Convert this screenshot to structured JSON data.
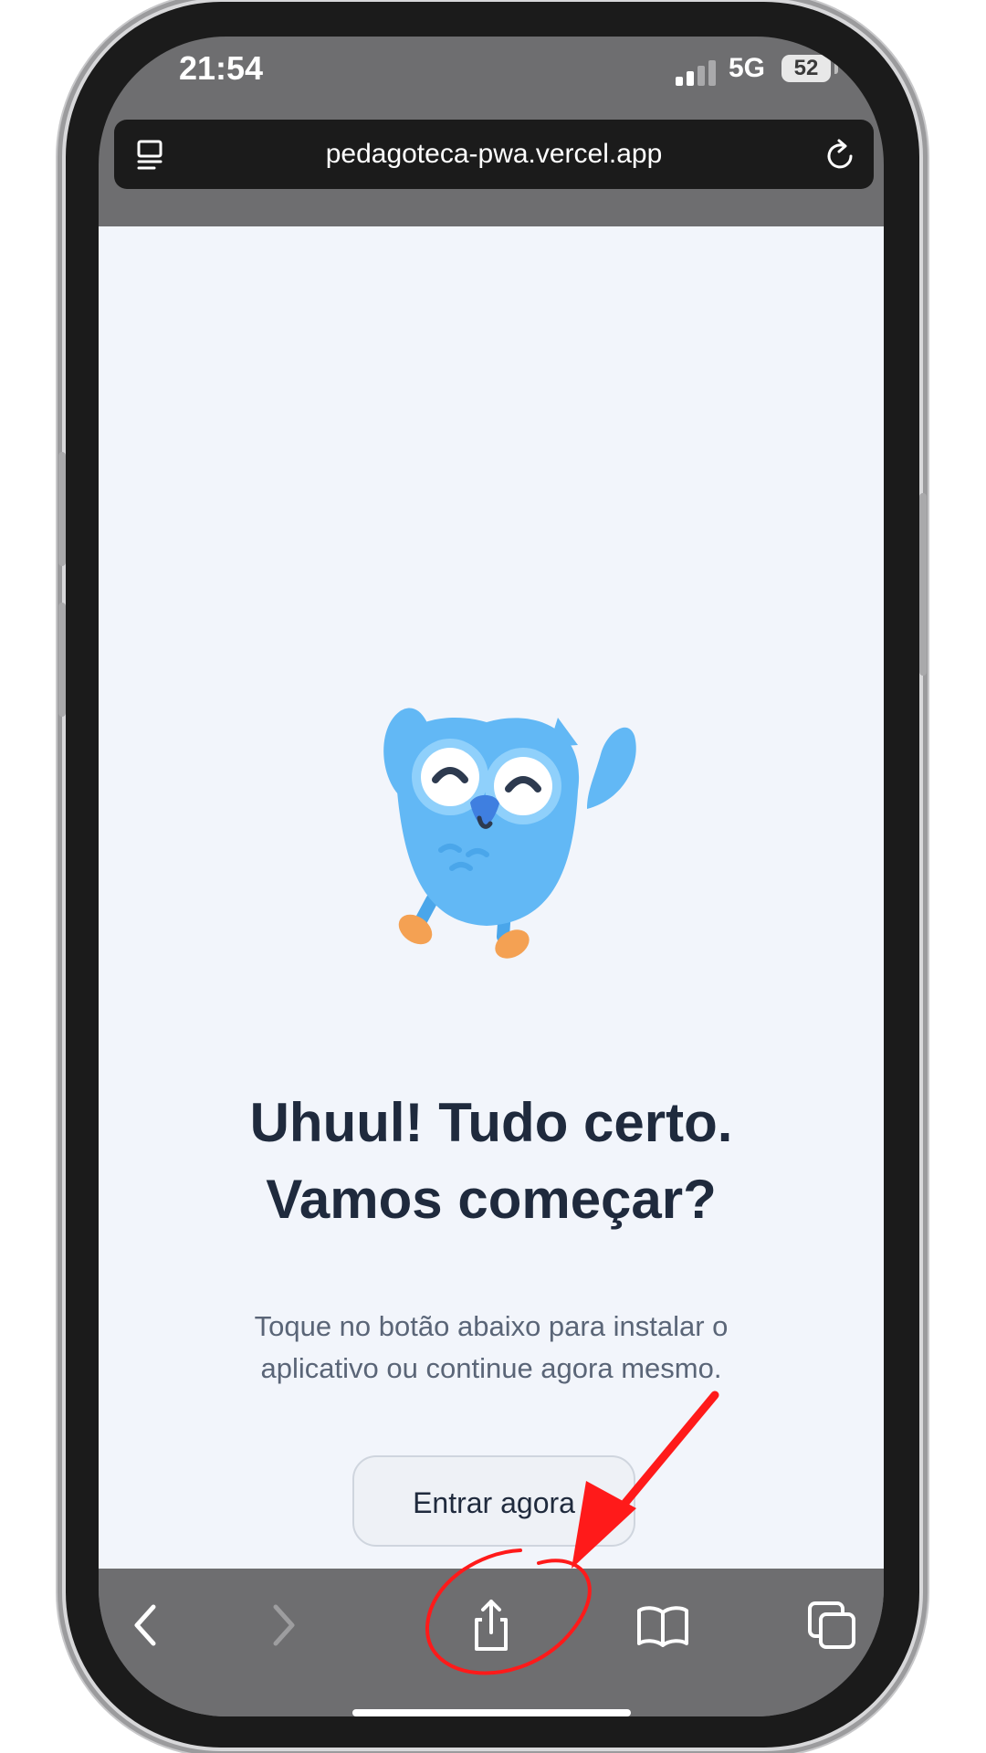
{
  "status_bar": {
    "time": "21:54",
    "network": "5G",
    "battery": "52"
  },
  "browser": {
    "url": "pedagoteca-pwa.vercel.app",
    "icons": {
      "left": "reader-icon",
      "right": "reload-icon"
    }
  },
  "page": {
    "headline_line1": "Uhuul! Tudo certo.",
    "headline_line2": "Vamos começar?",
    "subtext_line1": "Toque no botão abaixo para instalar o",
    "subtext_line2": "aplicativo ou continue agora mesmo.",
    "button_label": "Entrar agora"
  },
  "toolbar": {
    "icons": [
      "back-icon",
      "forward-icon",
      "share-icon",
      "bookmarks-icon",
      "tabs-icon"
    ]
  },
  "annotation": {
    "color": "#ff1a1a",
    "marks": [
      "arrow",
      "circle"
    ]
  },
  "colors": {
    "page_background": "#f2f5fb",
    "headline": "#1f2a3d",
    "mascot_blue": "#62b8f5",
    "mascot_feet": "#f4a153",
    "browser_chrome": "#6e6e70"
  }
}
